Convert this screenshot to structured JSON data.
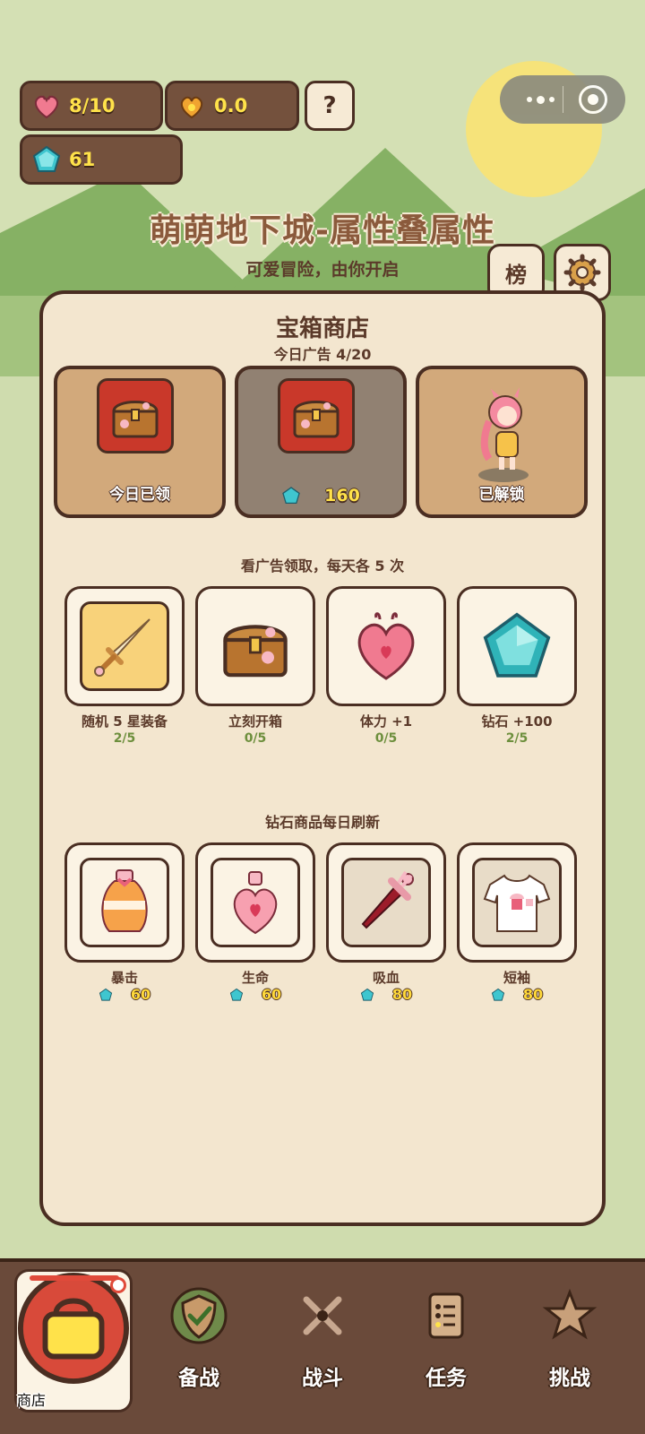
{
  "resources": {
    "stamina": "8/10",
    "gold": "0.0",
    "diamonds": "61",
    "help_label": "?"
  },
  "header": {
    "title": "萌萌地下城-属性叠属性",
    "subtitle": "可爱冒险，由你开启",
    "rank_label": "榜"
  },
  "shop": {
    "title": "宝箱商店",
    "ad_count": "今日广告 4/20",
    "top_cards": [
      {
        "label": "今日已领"
      },
      {
        "price": "160"
      },
      {
        "label": "已解锁"
      }
    ],
    "ad_section_label": "看广告领取，每天各 5 次",
    "ad_items": [
      {
        "name": "随机 5 星装备",
        "progress": "2/5",
        "icon": "sword-icon"
      },
      {
        "name": "立刻开箱",
        "progress": "0/5",
        "icon": "chest-icon"
      },
      {
        "name": "体力 +1",
        "progress": "0/5",
        "icon": "heart-potion-icon"
      },
      {
        "name": "钻石 +100",
        "progress": "2/5",
        "icon": "diamond-icon"
      }
    ],
    "diamond_section_label": "钻石商品每日刷新",
    "diamond_items": [
      {
        "name": "暴击",
        "price": "60",
        "icon": "orange-potion-icon"
      },
      {
        "name": "生命",
        "price": "60",
        "icon": "pink-potion-icon"
      },
      {
        "name": "吸血",
        "price": "80",
        "icon": "red-dagger-icon"
      },
      {
        "name": "短袖",
        "price": "80",
        "icon": "tshirt-icon"
      }
    ]
  },
  "nav": {
    "items": [
      {
        "label": "商店",
        "icon": "bag-icon",
        "active": true
      },
      {
        "label": "备战",
        "icon": "shield-icon"
      },
      {
        "label": "战斗",
        "icon": "crossed-swords-icon"
      },
      {
        "label": "任务",
        "icon": "list-icon"
      },
      {
        "label": "挑战",
        "icon": "star-icon"
      }
    ]
  },
  "colors": {
    "background": "#cfdcae",
    "panel": "#f3e6cf",
    "border": "#4a2e22",
    "accent_yellow": "#ffe24a",
    "nav_bg": "#6a4a3a"
  }
}
